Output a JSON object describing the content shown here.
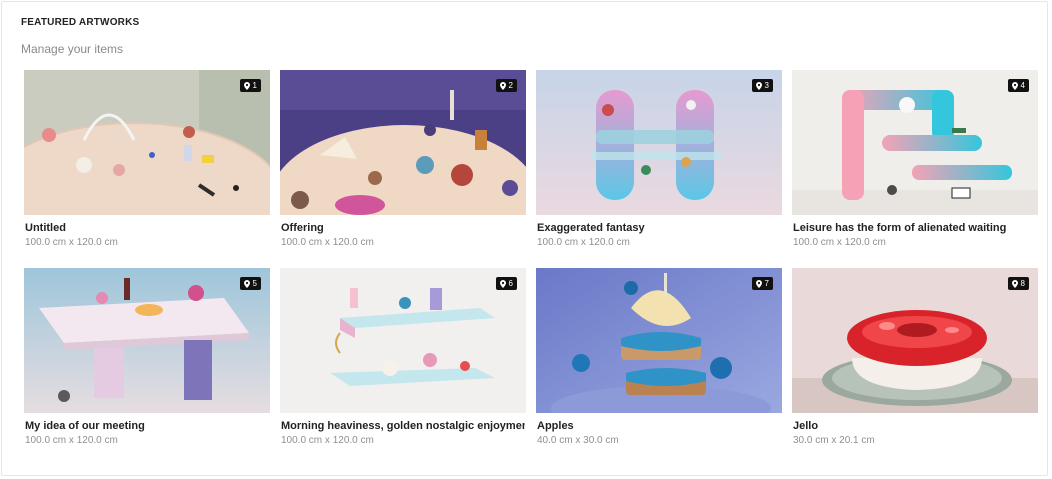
{
  "header": {
    "title": "FEATURED ARTWORKS",
    "subtitle": "Manage your items"
  },
  "artworks": [
    {
      "index": "1",
      "title": "Untitled",
      "size": "100.0 cm x 120.0 cm",
      "icon": "location-pin-icon"
    },
    {
      "index": "2",
      "title": "Offering",
      "size": "100.0 cm x 120.0 cm",
      "icon": "location-pin-icon"
    },
    {
      "index": "3",
      "title": "Exaggerated fantasy",
      "size": "100.0 cm x 120.0 cm",
      "icon": "location-pin-icon"
    },
    {
      "index": "4",
      "title": "Leisure has the form of alienated waiting",
      "size": "100.0 cm x 120.0 cm",
      "icon": "location-pin-icon"
    },
    {
      "index": "5",
      "title": "My idea of our meeting",
      "size": "100.0 cm x 120.0 cm",
      "icon": "location-pin-icon"
    },
    {
      "index": "6",
      "title": "Morning heaviness, golden nostalgic enjoyment",
      "size": "100.0 cm x 120.0 cm",
      "icon": "location-pin-icon"
    },
    {
      "index": "7",
      "title": "Apples",
      "size": "40.0 cm x 30.0 cm",
      "icon": "location-pin-icon"
    },
    {
      "index": "8",
      "title": "Jello",
      "size": "30.0 cm x 20.1 cm",
      "icon": "location-pin-icon"
    }
  ]
}
